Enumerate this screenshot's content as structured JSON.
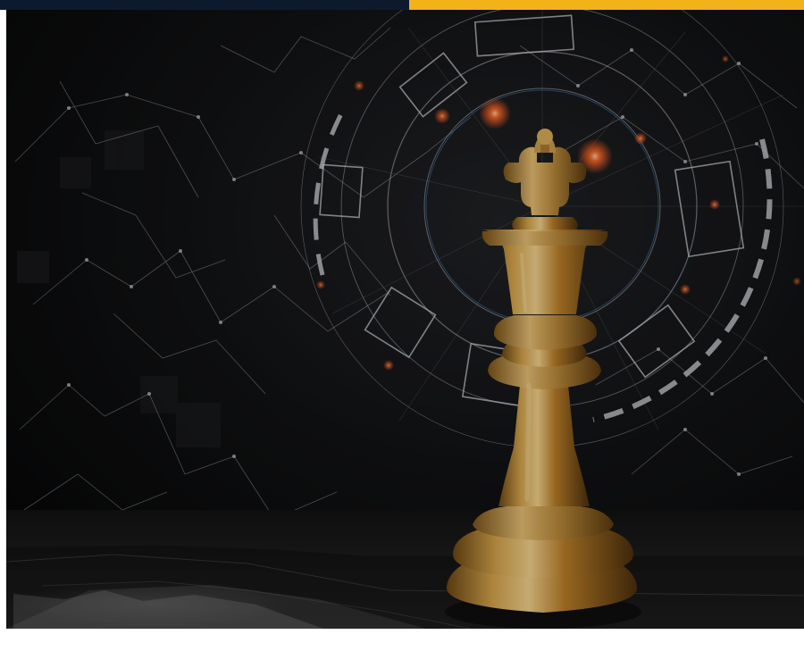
{
  "page": {
    "background": "#ffffff"
  },
  "top_bar": {
    "left_color": "#0d1a2e",
    "right_color": "#f2b21a"
  },
  "hero_image": {
    "subject": "gold-chess-king",
    "background_color": "#050505",
    "accent_glow_color": "#ff5a1f",
    "hud_color": "#b9bec8",
    "piece_color": "#c99a45"
  }
}
